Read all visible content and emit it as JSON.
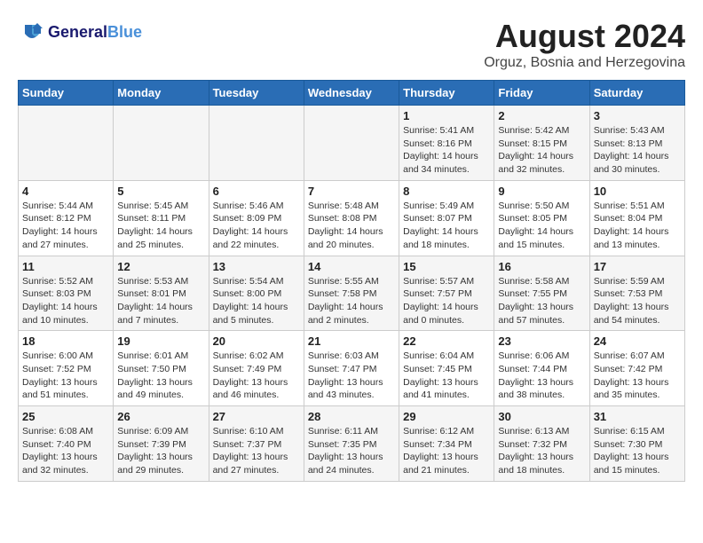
{
  "logo": {
    "general": "General",
    "blue": "Blue"
  },
  "title": "August 2024",
  "subtitle": "Orguz, Bosnia and Herzegovina",
  "days_of_week": [
    "Sunday",
    "Monday",
    "Tuesday",
    "Wednesday",
    "Thursday",
    "Friday",
    "Saturday"
  ],
  "weeks": [
    [
      {
        "day": "",
        "info": ""
      },
      {
        "day": "",
        "info": ""
      },
      {
        "day": "",
        "info": ""
      },
      {
        "day": "",
        "info": ""
      },
      {
        "day": "1",
        "info": "Sunrise: 5:41 AM\nSunset: 8:16 PM\nDaylight: 14 hours\nand 34 minutes."
      },
      {
        "day": "2",
        "info": "Sunrise: 5:42 AM\nSunset: 8:15 PM\nDaylight: 14 hours\nand 32 minutes."
      },
      {
        "day": "3",
        "info": "Sunrise: 5:43 AM\nSunset: 8:13 PM\nDaylight: 14 hours\nand 30 minutes."
      }
    ],
    [
      {
        "day": "4",
        "info": "Sunrise: 5:44 AM\nSunset: 8:12 PM\nDaylight: 14 hours\nand 27 minutes."
      },
      {
        "day": "5",
        "info": "Sunrise: 5:45 AM\nSunset: 8:11 PM\nDaylight: 14 hours\nand 25 minutes."
      },
      {
        "day": "6",
        "info": "Sunrise: 5:46 AM\nSunset: 8:09 PM\nDaylight: 14 hours\nand 22 minutes."
      },
      {
        "day": "7",
        "info": "Sunrise: 5:48 AM\nSunset: 8:08 PM\nDaylight: 14 hours\nand 20 minutes."
      },
      {
        "day": "8",
        "info": "Sunrise: 5:49 AM\nSunset: 8:07 PM\nDaylight: 14 hours\nand 18 minutes."
      },
      {
        "day": "9",
        "info": "Sunrise: 5:50 AM\nSunset: 8:05 PM\nDaylight: 14 hours\nand 15 minutes."
      },
      {
        "day": "10",
        "info": "Sunrise: 5:51 AM\nSunset: 8:04 PM\nDaylight: 14 hours\nand 13 minutes."
      }
    ],
    [
      {
        "day": "11",
        "info": "Sunrise: 5:52 AM\nSunset: 8:03 PM\nDaylight: 14 hours\nand 10 minutes."
      },
      {
        "day": "12",
        "info": "Sunrise: 5:53 AM\nSunset: 8:01 PM\nDaylight: 14 hours\nand 7 minutes."
      },
      {
        "day": "13",
        "info": "Sunrise: 5:54 AM\nSunset: 8:00 PM\nDaylight: 14 hours\nand 5 minutes."
      },
      {
        "day": "14",
        "info": "Sunrise: 5:55 AM\nSunset: 7:58 PM\nDaylight: 14 hours\nand 2 minutes."
      },
      {
        "day": "15",
        "info": "Sunrise: 5:57 AM\nSunset: 7:57 PM\nDaylight: 14 hours\nand 0 minutes."
      },
      {
        "day": "16",
        "info": "Sunrise: 5:58 AM\nSunset: 7:55 PM\nDaylight: 13 hours\nand 57 minutes."
      },
      {
        "day": "17",
        "info": "Sunrise: 5:59 AM\nSunset: 7:53 PM\nDaylight: 13 hours\nand 54 minutes."
      }
    ],
    [
      {
        "day": "18",
        "info": "Sunrise: 6:00 AM\nSunset: 7:52 PM\nDaylight: 13 hours\nand 51 minutes."
      },
      {
        "day": "19",
        "info": "Sunrise: 6:01 AM\nSunset: 7:50 PM\nDaylight: 13 hours\nand 49 minutes."
      },
      {
        "day": "20",
        "info": "Sunrise: 6:02 AM\nSunset: 7:49 PM\nDaylight: 13 hours\nand 46 minutes."
      },
      {
        "day": "21",
        "info": "Sunrise: 6:03 AM\nSunset: 7:47 PM\nDaylight: 13 hours\nand 43 minutes."
      },
      {
        "day": "22",
        "info": "Sunrise: 6:04 AM\nSunset: 7:45 PM\nDaylight: 13 hours\nand 41 minutes."
      },
      {
        "day": "23",
        "info": "Sunrise: 6:06 AM\nSunset: 7:44 PM\nDaylight: 13 hours\nand 38 minutes."
      },
      {
        "day": "24",
        "info": "Sunrise: 6:07 AM\nSunset: 7:42 PM\nDaylight: 13 hours\nand 35 minutes."
      }
    ],
    [
      {
        "day": "25",
        "info": "Sunrise: 6:08 AM\nSunset: 7:40 PM\nDaylight: 13 hours\nand 32 minutes."
      },
      {
        "day": "26",
        "info": "Sunrise: 6:09 AM\nSunset: 7:39 PM\nDaylight: 13 hours\nand 29 minutes."
      },
      {
        "day": "27",
        "info": "Sunrise: 6:10 AM\nSunset: 7:37 PM\nDaylight: 13 hours\nand 27 minutes."
      },
      {
        "day": "28",
        "info": "Sunrise: 6:11 AM\nSunset: 7:35 PM\nDaylight: 13 hours\nand 24 minutes."
      },
      {
        "day": "29",
        "info": "Sunrise: 6:12 AM\nSunset: 7:34 PM\nDaylight: 13 hours\nand 21 minutes."
      },
      {
        "day": "30",
        "info": "Sunrise: 6:13 AM\nSunset: 7:32 PM\nDaylight: 13 hours\nand 18 minutes."
      },
      {
        "day": "31",
        "info": "Sunrise: 6:15 AM\nSunset: 7:30 PM\nDaylight: 13 hours\nand 15 minutes."
      }
    ]
  ]
}
